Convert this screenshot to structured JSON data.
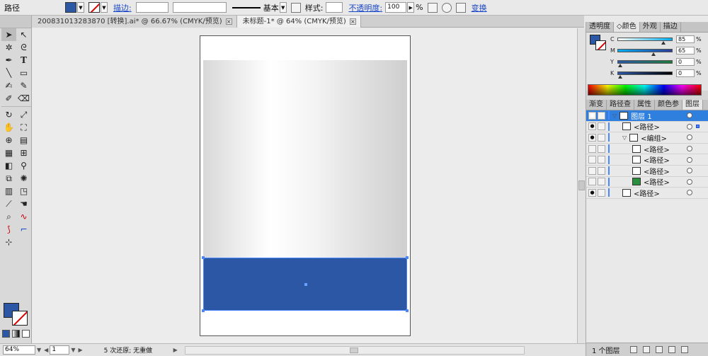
{
  "control_bar": {
    "object_type": "路径",
    "fill_color": "#2b57a5",
    "stroke_label": "描边:",
    "stroke_weight": "",
    "profile": "",
    "brush_style": "基本",
    "style_label": "样式:",
    "opacity_label": "不透明度:",
    "opacity_value": "100",
    "opacity_unit": "%",
    "transform_label": "变换"
  },
  "tabs": [
    {
      "label": "200831013283870 [转换].ai* @ 66.67% (CMYK/预览)",
      "close": "×"
    },
    {
      "label": "未标题-1* @ 64% (CMYK/预览)",
      "close": "×"
    }
  ],
  "tools": {
    "icons": [
      "selection-icon",
      "direct-selection-icon",
      "magic-wand-icon",
      "lasso-icon",
      "pen-icon",
      "type-icon",
      "line-segment-icon",
      "rectangle-icon",
      "paintbrush-icon",
      "pencil-icon",
      "blob-brush-icon",
      "eraser-icon",
      "rotate-icon",
      "scale-icon",
      "warp-icon",
      "free-transform-icon",
      "shape-builder-icon",
      "live-paint-icon",
      "perspective-grid-icon",
      "mesh-icon",
      "gradient-icon",
      "eyedropper-icon",
      "blend-icon",
      "symbol-sprayer-icon",
      "column-graph-icon",
      "artboard-icon",
      "slice-icon",
      "hand-icon",
      "zoom-icon"
    ],
    "fill_color": "#2b57a5"
  },
  "canvas": {
    "shape_fill": "#2b57a5",
    "selection_color": "#4a86ff"
  },
  "status_bar": {
    "zoom": "64%",
    "artboard_number": "1",
    "status_text": "5 次还原; 无重做"
  },
  "color_panel": {
    "tabs": [
      "透明度",
      "颜色",
      "外观",
      "描边"
    ],
    "active_tab": 1,
    "tab_marker": "◇",
    "sliders": [
      {
        "label": "C",
        "value": "85",
        "percent": 85,
        "unit": "%"
      },
      {
        "label": "M",
        "value": "65",
        "percent": 65,
        "unit": "%"
      },
      {
        "label": "Y",
        "value": "0",
        "percent": 0,
        "unit": "%"
      },
      {
        "label": "K",
        "value": "0",
        "percent": 0,
        "unit": "%"
      }
    ]
  },
  "layers_panel": {
    "tabs": [
      "渐变",
      "路径查",
      "属性",
      "颜色参",
      "图层"
    ],
    "active_tab": 4,
    "rows": [
      {
        "name": "图层 1",
        "indent": 0,
        "eye": true,
        "expand": "▽",
        "top": true,
        "selected": false
      },
      {
        "name": "<路径>",
        "indent": 1,
        "eye": true,
        "expand": "",
        "top": false,
        "selected": true
      },
      {
        "name": "<编组>",
        "indent": 1,
        "eye": true,
        "expand": "▽",
        "top": false,
        "selected": false
      },
      {
        "name": "<路径>",
        "indent": 2,
        "eye": false,
        "expand": "",
        "top": false,
        "selected": false
      },
      {
        "name": "<路径>",
        "indent": 2,
        "eye": false,
        "expand": "",
        "top": false,
        "selected": false
      },
      {
        "name": "<路径>",
        "indent": 2,
        "eye": false,
        "expand": "",
        "top": false,
        "selected": false
      },
      {
        "name": "<路径>",
        "indent": 2,
        "eye": false,
        "expand": "",
        "top": false,
        "selected": false,
        "thumb": "#2c8f3f"
      },
      {
        "name": "<路径>",
        "indent": 1,
        "eye": true,
        "expand": "",
        "top": false,
        "selected": false
      }
    ],
    "footer": "1 个图层"
  }
}
